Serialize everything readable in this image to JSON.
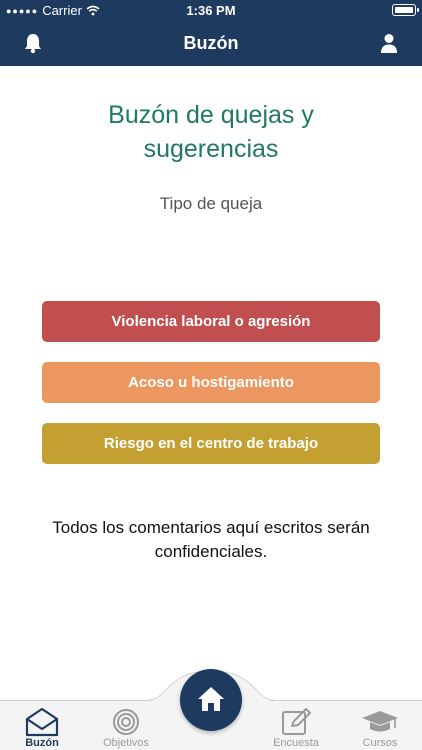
{
  "status_bar": {
    "carrier": "Carrier",
    "time": "1:36 PM"
  },
  "header": {
    "title": "Buzón"
  },
  "main": {
    "title": "Buzón de quejas y sugerencias",
    "subtitle": "Tipo de queja",
    "options": [
      {
        "label": "Violencia laboral o agresión",
        "color": "#c24f4f"
      },
      {
        "label": "Acoso u hostigamiento",
        "color": "#ec9660"
      },
      {
        "label": "Riesgo en el centro de trabajo",
        "color": "#c4a033"
      }
    ],
    "note": "Todos los comentarios aquí escritos serán confidenciales."
  },
  "tabbar": {
    "tabs": [
      {
        "label": "Buzón",
        "icon": "mail-icon",
        "active": true
      },
      {
        "label": "Objetivos",
        "icon": "target-icon",
        "active": false
      },
      {
        "label": "Encuesta",
        "icon": "edit-icon",
        "active": false
      },
      {
        "label": "Cursos",
        "icon": "graduation-cap-icon",
        "active": false
      }
    ],
    "center": {
      "icon": "home-icon"
    }
  },
  "colors": {
    "primary": "#1f3a5f",
    "title": "#1f7a5f"
  }
}
